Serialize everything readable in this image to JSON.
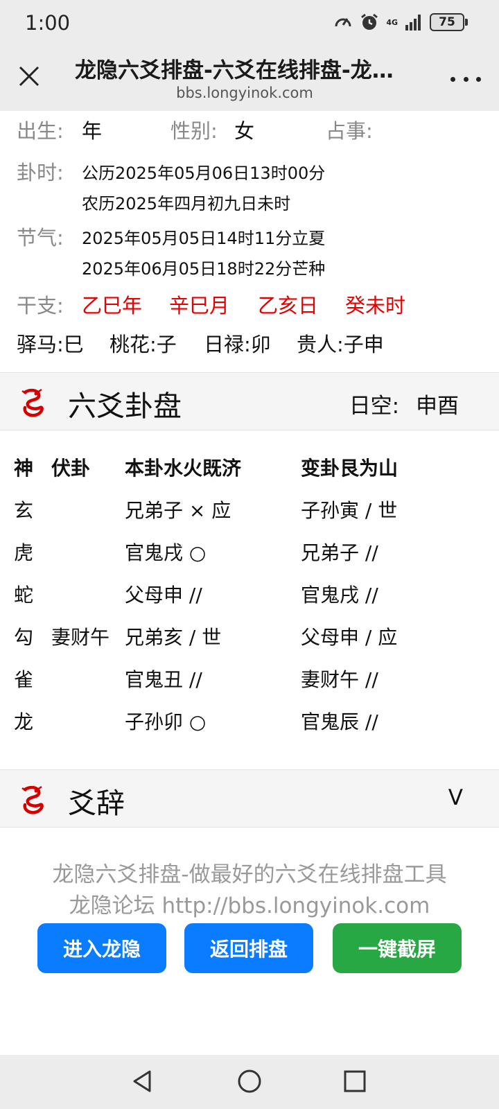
{
  "status_bar": {
    "time": "1:00",
    "network": "4G",
    "battery": "75"
  },
  "browser": {
    "title": "龙隐六爻排盘-六爻在线排盘-龙隐论坛",
    "url": "bbs.longyinok.com"
  },
  "info": {
    "birth_label": "出生:",
    "birth_value": "年",
    "gender_label": "性别:",
    "gender_value": "女",
    "matter_label": "占事:",
    "matter_value": "",
    "time_label": "卦时:",
    "solar": "公历2025年05月06日13时00分",
    "lunar": "农历2025年四月初九日未时",
    "term_label": "节气:",
    "term1": "2025年05月05日14时11分立夏",
    "term2": "2025年06月05日18时22分芒种",
    "ganzhi_label": "干支:",
    "ganzhi": [
      "乙巳年",
      "辛巳月",
      "乙亥日",
      "癸未时"
    ],
    "extras": [
      "驿马:巳",
      "桃花:子",
      "日禄:卯",
      "贵人:子申"
    ]
  },
  "gua_section": {
    "title": "六爻卦盘",
    "void_label": "日空:",
    "void_value": "申酉"
  },
  "table": {
    "headers": [
      "神",
      "伏卦",
      "本卦水火既济",
      "变卦艮为山"
    ],
    "rows": [
      [
        "玄",
        "",
        "兄弟子 × 应",
        "子孙寅  / 世"
      ],
      [
        "虎",
        "",
        "官鬼戌 ○",
        "兄弟子 //"
      ],
      [
        "蛇",
        "",
        "父母申 //",
        "官鬼戌 //"
      ],
      [
        "勾",
        "妻财午",
        "兄弟亥  / 世",
        "父母申  / 应"
      ],
      [
        "雀",
        "",
        "官鬼丑 //",
        "妻财午 //"
      ],
      [
        "龙",
        "",
        "子孙卯 ○",
        "官鬼辰 //"
      ]
    ]
  },
  "yao_section": {
    "title": "爻辞",
    "toggle": "V"
  },
  "footer": {
    "line1": "龙隐六爻排盘-做最好的六爻在线排盘工具",
    "line2": "龙隐论坛 http://bbs.longyinok.com",
    "buttons": [
      "进入龙隐",
      "返回排盘",
      "一键截屏"
    ]
  },
  "colors": {
    "accent_blue": "#0a7cff",
    "accent_green": "#28a745",
    "ganzhi_red": "#e60000"
  },
  "icons": [
    "close-icon",
    "more-icon",
    "dragon-logo-icon",
    "back-icon",
    "home-icon",
    "recents-icon"
  ]
}
